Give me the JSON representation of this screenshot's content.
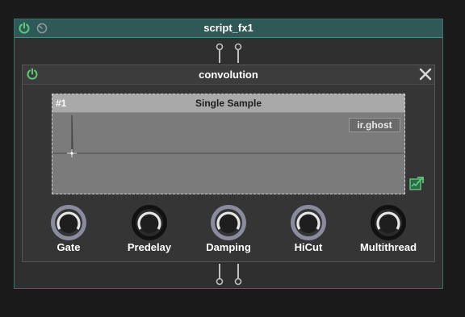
{
  "outer_module": {
    "title": "script_fx1",
    "power_icon": "power-icon",
    "clock_icon": "clock-icon",
    "accent_color": "#2e5957"
  },
  "inner_module": {
    "title": "convolution",
    "power_icon": "power-icon",
    "close_icon": "close-icon"
  },
  "sample_panel": {
    "index": "#1",
    "mode": "Single Sample",
    "ir_name": "ir.ghost",
    "export_icon": "export-icon"
  },
  "knobs": [
    {
      "label": "Gate",
      "style": "light"
    },
    {
      "label": "Predelay",
      "style": "dark"
    },
    {
      "label": "Damping",
      "style": "light"
    },
    {
      "label": "HiCut",
      "style": "light"
    },
    {
      "label": "Multithread",
      "style": "dark"
    }
  ],
  "colors": {
    "power_green": "#5ec97a",
    "header_teal": "#2e5957",
    "background": "#1a1a1a"
  }
}
